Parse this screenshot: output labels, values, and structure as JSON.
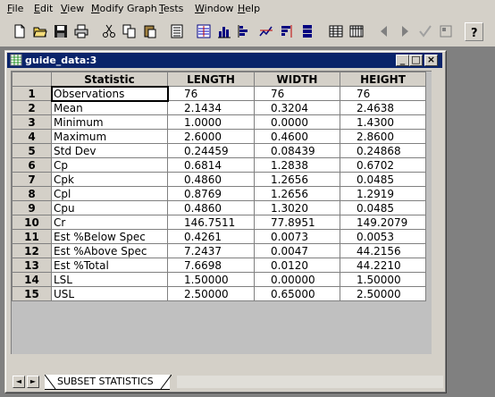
{
  "menu": {
    "file": "File",
    "edit": "Edit",
    "view": "View",
    "modify_graph": "Modify Graph",
    "tests": "Tests",
    "window": "Window",
    "help": "Help"
  },
  "toolbar": {
    "icons": [
      "new-file-icon",
      "open-folder-icon",
      "save-icon",
      "print-icon",
      "cut-icon",
      "copy-icon",
      "paste-icon",
      "calculator-icon",
      "histogram-icon",
      "bar-chart-icon",
      "grid-chart-icon",
      "trend-chart-icon",
      "control-chart-icon",
      "stack-chart-icon",
      "table-icon",
      "table-alt-icon",
      "prev-icon",
      "next-icon",
      "check-icon",
      "window-icon",
      "help-icon"
    ]
  },
  "window": {
    "title": "guide_data:3",
    "min_symbol": "_",
    "max_symbol": "□",
    "close_symbol": "×"
  },
  "table": {
    "headers": [
      "",
      "Statistic",
      "LENGTH",
      "WIDTH",
      "HEIGHT"
    ],
    "rows": [
      [
        "1",
        "Observations",
        "76",
        "76",
        "76"
      ],
      [
        "2",
        "Mean",
        "2.1434",
        "0.3204",
        "2.4638"
      ],
      [
        "3",
        "Minimum",
        "1.0000",
        "0.0000",
        "1.4300"
      ],
      [
        "4",
        "Maximum",
        "2.6000",
        "0.4600",
        "2.8600"
      ],
      [
        "5",
        "Std Dev",
        "0.24459",
        "0.08439",
        "0.24868"
      ],
      [
        "6",
        "Cp",
        "0.6814",
        "1.2838",
        "0.6702"
      ],
      [
        "7",
        "Cpk",
        "0.4860",
        "1.2656",
        "0.0485"
      ],
      [
        "8",
        "Cpl",
        "0.8769",
        "1.2656",
        "1.2919"
      ],
      [
        "9",
        "Cpu",
        "0.4860",
        "1.3020",
        "0.0485"
      ],
      [
        "10",
        "Cr",
        "146.7511",
        "77.8951",
        "149.2079"
      ],
      [
        "11",
        "Est %Below Spec",
        "0.4261",
        "0.0073",
        "0.0053"
      ],
      [
        "12",
        "Est %Above Spec",
        "7.2437",
        "0.0047",
        "44.2156"
      ],
      [
        "13",
        "Est %Total",
        "7.6698",
        "0.0120",
        "44.2210"
      ],
      [
        "14",
        "LSL",
        "1.50000",
        "0.00000",
        "1.50000"
      ],
      [
        "15",
        "USL",
        "2.50000",
        "0.65000",
        "2.50000"
      ]
    ]
  },
  "sheet": {
    "tab_label": "SUBSET STATISTICS",
    "nav_prev": "◄",
    "nav_next": "►"
  }
}
